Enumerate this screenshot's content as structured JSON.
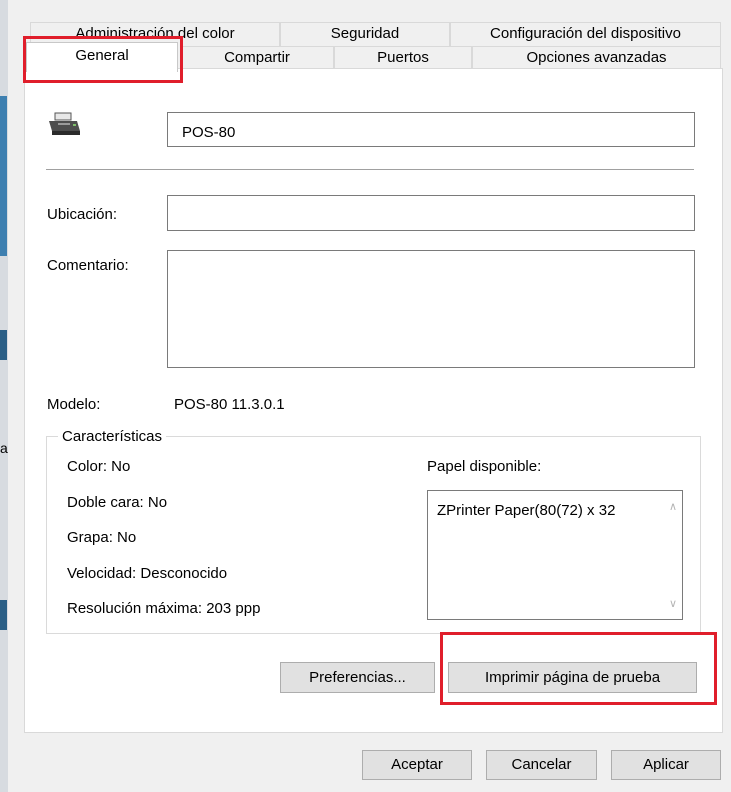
{
  "tabs": {
    "row_back": {
      "color_management": "Administración del color",
      "security": "Seguridad",
      "device_settings": "Configuración del dispositivo"
    },
    "row_front": {
      "general": "General",
      "sharing": "Compartir",
      "ports": "Puertos",
      "advanced": "Opciones avanzadas"
    }
  },
  "general": {
    "printer_icon": "printer-icon",
    "printer_name": "POS-80",
    "location_label": "Ubicación:",
    "location_value": "",
    "comment_label": "Comentario:",
    "comment_value": "",
    "model_label": "Modelo:",
    "model_value": "POS-80 11.3.0.1"
  },
  "features": {
    "title": "Características",
    "color": "Color: No",
    "duplex": "Doble cara: No",
    "staple": "Grapa: No",
    "speed": "Velocidad: Desconocido",
    "max_resolution": "Resolución máxima: 203 ppp",
    "paper_label": "Papel disponible:",
    "paper_items": [
      "ZPrinter Paper(80(72) x 32"
    ]
  },
  "buttons": {
    "preferences": "Preferencias...",
    "print_test_page": "Imprimir página de prueba",
    "ok": "Aceptar",
    "cancel": "Cancelar",
    "apply": "Aplicar"
  },
  "colors": {
    "highlight": "#e01e2b"
  }
}
